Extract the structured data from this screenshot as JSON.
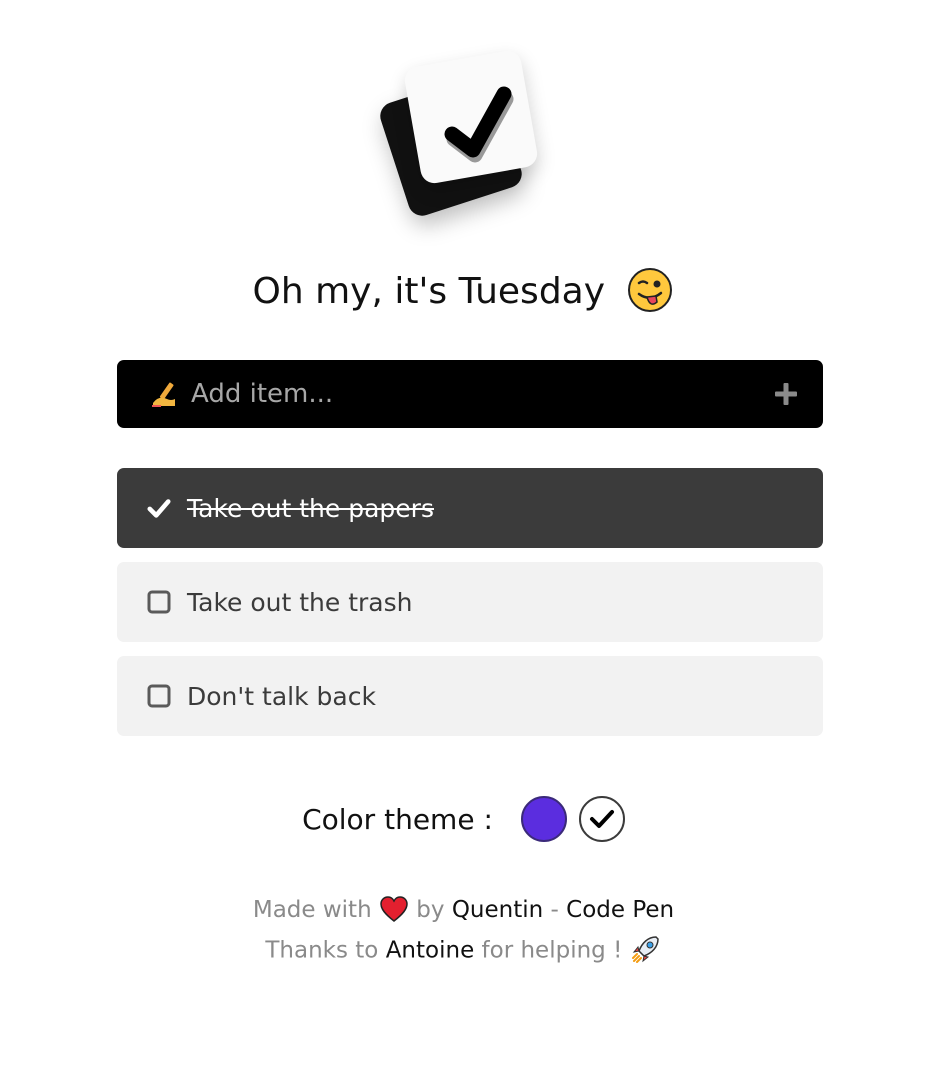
{
  "title": {
    "text": "Oh my, it's Tuesday",
    "emoji": "winking-face-with-tongue"
  },
  "add_item": {
    "placeholder": "Add item...",
    "leading_icon": "writing-hand-icon",
    "action_icon": "plus-icon"
  },
  "todos": [
    {
      "label": "Take out the papers",
      "done": true
    },
    {
      "label": "Take out the trash",
      "done": false
    },
    {
      "label": "Don't talk back",
      "done": false
    }
  ],
  "theme": {
    "label": "Color theme :",
    "options": [
      {
        "name": "purple",
        "color": "#5b2ddf",
        "selected": false
      },
      {
        "name": "white",
        "color": "#ffffff",
        "selected": true
      }
    ]
  },
  "footer": {
    "line1": {
      "made_with": "Made with",
      "heart_icon": "heart-icon",
      "by": "by",
      "author": "Quentin",
      "separator": "-",
      "link": "Code Pen"
    },
    "line2": {
      "thanks_to": "Thanks to",
      "helper": "Antoine",
      "for_helping": "for helping !",
      "rocket_icon": "rocket-icon"
    }
  },
  "colors": {
    "accent_dark": "#000000",
    "done_item_bg": "#3b3b3b",
    "open_item_bg": "#f2f2f2",
    "muted_text": "#8a8a8a"
  }
}
